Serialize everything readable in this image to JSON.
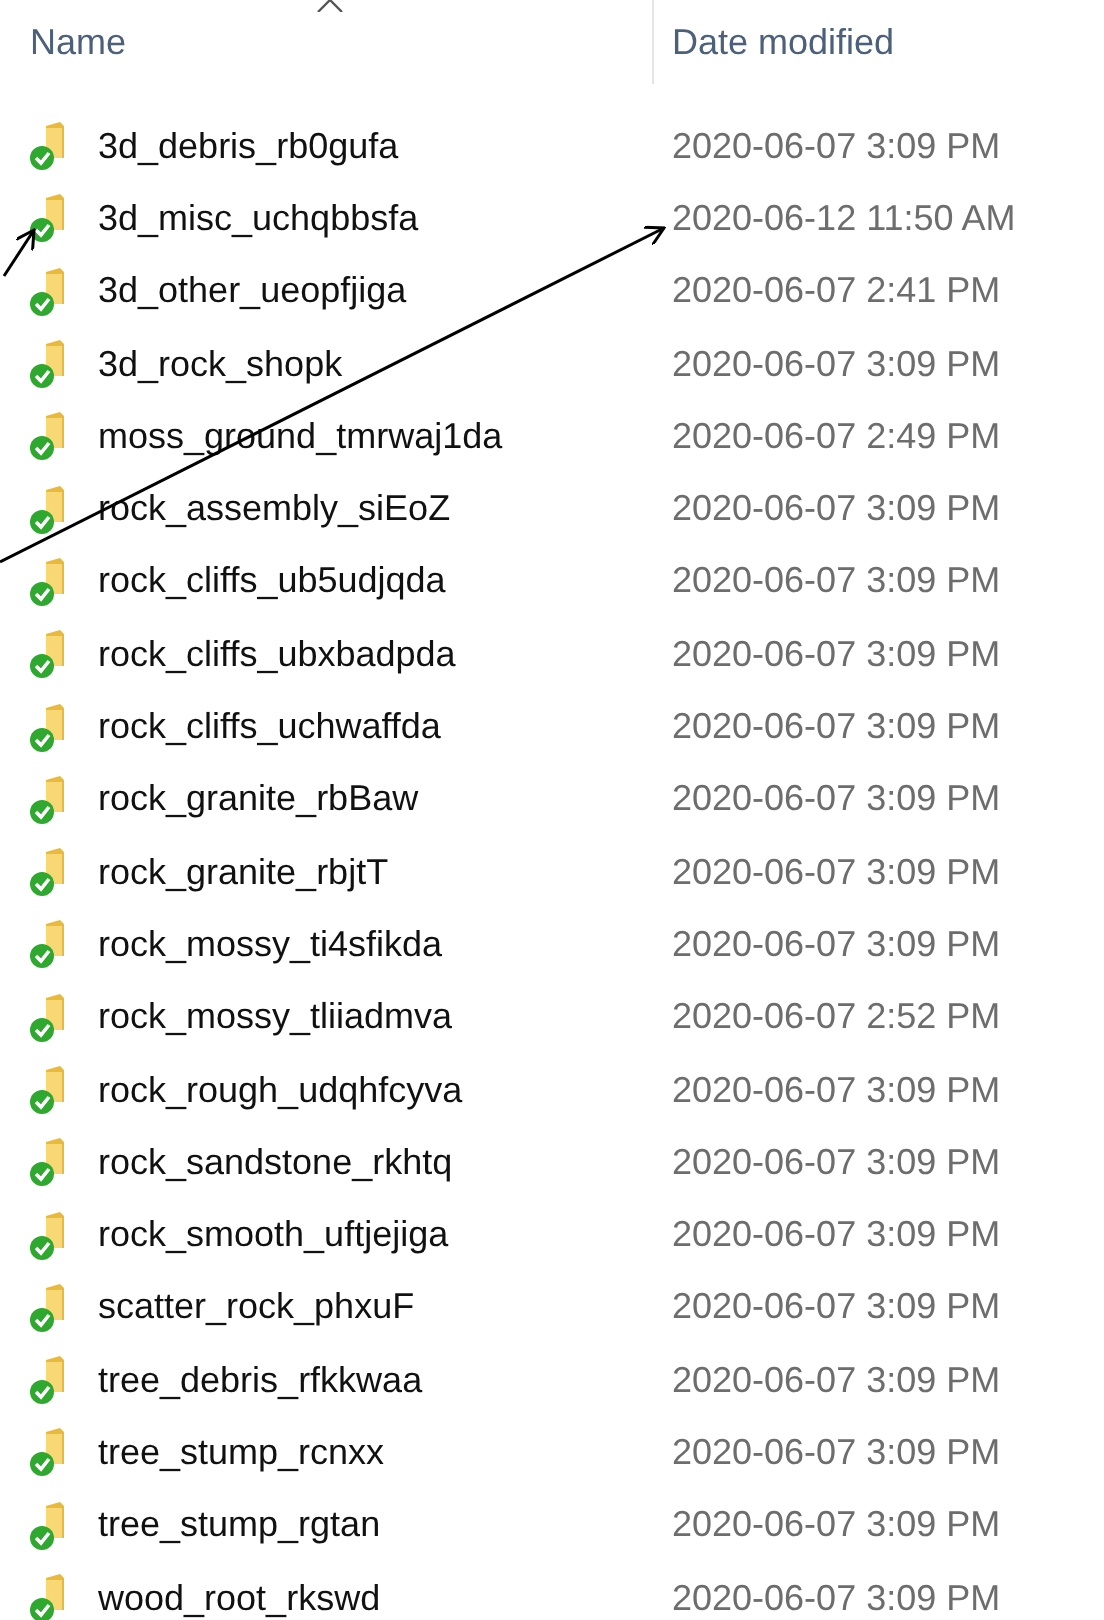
{
  "columns": [
    {
      "label": "Name",
      "sorted": true
    },
    {
      "label": "Date modified",
      "sorted": false
    }
  ],
  "rows": [
    {
      "name": "3d_debris_rb0gufa",
      "date": "2020-06-07 3:09 PM"
    },
    {
      "name": "3d_misc_uchqbbsfa",
      "date": "2020-06-12 11:50 AM"
    },
    {
      "name": "3d_other_ueopfjiga",
      "date": "2020-06-07 2:41 PM"
    },
    {
      "name": "3d_rock_shopk",
      "date": "2020-06-07 3:09 PM"
    },
    {
      "name": "moss_ground_tmrwaj1da",
      "date": "2020-06-07 2:49 PM"
    },
    {
      "name": "rock_assembly_siEoZ",
      "date": "2020-06-07 3:09 PM"
    },
    {
      "name": "rock_cliffs_ub5udjqda",
      "date": "2020-06-07 3:09 PM"
    },
    {
      "name": "rock_cliffs_ubxbadpda",
      "date": "2020-06-07 3:09 PM"
    },
    {
      "name": "rock_cliffs_uchwaffda",
      "date": "2020-06-07 3:09 PM"
    },
    {
      "name": "rock_granite_rbBaw",
      "date": "2020-06-07 3:09 PM"
    },
    {
      "name": "rock_granite_rbjtT",
      "date": "2020-06-07 3:09 PM"
    },
    {
      "name": "rock_mossy_ti4sfikda",
      "date": "2020-06-07 3:09 PM"
    },
    {
      "name": "rock_mossy_tliiadmva",
      "date": "2020-06-07 2:52 PM"
    },
    {
      "name": "rock_rough_udqhfcyva",
      "date": "2020-06-07 3:09 PM"
    },
    {
      "name": "rock_sandstone_rkhtq",
      "date": "2020-06-07 3:09 PM"
    },
    {
      "name": "rock_smooth_uftjejiga",
      "date": "2020-06-07 3:09 PM"
    },
    {
      "name": "scatter_rock_phxuF",
      "date": "2020-06-07 3:09 PM"
    },
    {
      "name": "tree_debris_rfkkwaa",
      "date": "2020-06-07 3:09 PM"
    },
    {
      "name": "tree_stump_rcnxx",
      "date": "2020-06-07 3:09 PM"
    },
    {
      "name": "tree_stump_rgtan",
      "date": "2020-06-07 3:09 PM"
    },
    {
      "name": "wood_root_rkswd",
      "date": "2020-06-07 3:09 PM"
    }
  ]
}
